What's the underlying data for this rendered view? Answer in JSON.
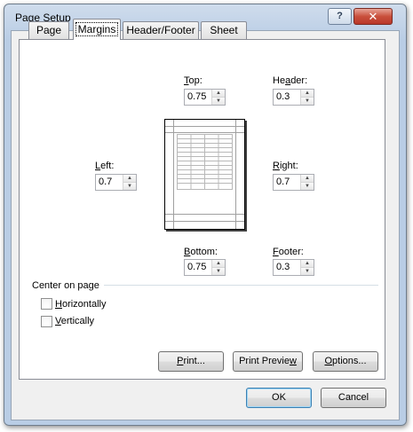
{
  "window": {
    "title": "Page Setup",
    "help_glyph": "?",
    "close_glyph": "✕"
  },
  "tabs": [
    {
      "label": "Page",
      "active": false
    },
    {
      "label": "Margins",
      "active": true
    },
    {
      "label": "Header/Footer",
      "active": false
    },
    {
      "label": "Sheet",
      "active": false
    }
  ],
  "margins": {
    "top": {
      "mnemonic": "T",
      "rest": "op:",
      "value": "0.75"
    },
    "header": {
      "pre": "He",
      "mnemonic": "a",
      "rest": "der:",
      "value": "0.3"
    },
    "left": {
      "mnemonic": "L",
      "rest": "eft:",
      "value": "0.7"
    },
    "right": {
      "mnemonic": "R",
      "rest": "ight:",
      "value": "0.7"
    },
    "bottom": {
      "mnemonic": "B",
      "rest": "ottom:",
      "value": "0.75"
    },
    "footer": {
      "mnemonic": "F",
      "rest": "ooter:",
      "value": "0.3"
    }
  },
  "center_on_page": {
    "heading": "Center on page",
    "horizontally": {
      "mnemonic": "H",
      "rest": "orizontally",
      "checked": false
    },
    "vertically": {
      "mnemonic": "V",
      "rest": "ertically",
      "checked": false
    }
  },
  "buttons": {
    "print": {
      "mnemonic": "P",
      "rest": "rint..."
    },
    "print_preview": {
      "pre": "Print Previe",
      "mnemonic": "w",
      "rest": ""
    },
    "options": {
      "mnemonic": "O",
      "rest": "ptions..."
    },
    "ok": "OK",
    "cancel": "Cancel"
  },
  "spinner_arrows": {
    "up": "▲",
    "down": "▼"
  }
}
